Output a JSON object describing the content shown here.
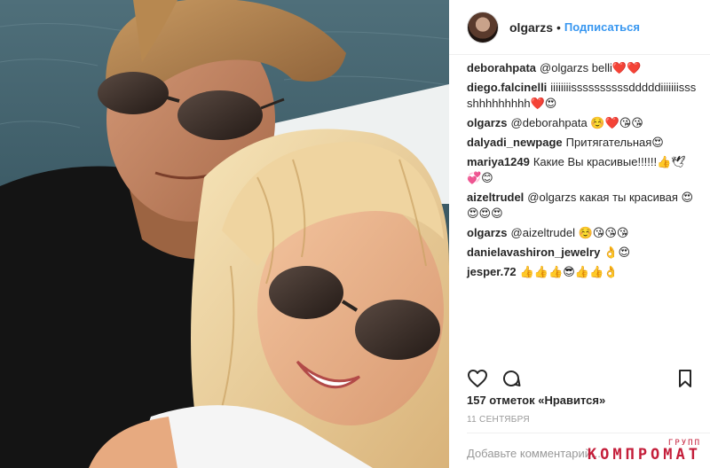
{
  "post": {
    "username": "olgarzs",
    "separator": "•",
    "follow_label": "Подписаться"
  },
  "comments": [
    {
      "user": "deborahpata",
      "text": "@olgarzs belli❤️❤️"
    },
    {
      "user": "diego.falcinelli",
      "text": "iiiiiiiissssssssssdddddiiiiiiisssshhhhhhhhh❤️😍"
    },
    {
      "user": "olgarzs",
      "text": "@deborahpata ☺️❤️😘😘"
    },
    {
      "user": "dalyadi_newpage",
      "text": "Притягательная😍"
    },
    {
      "user": "mariya1249",
      "text": "Какие Вы красивые!!!!!!👍🕊💞😊"
    },
    {
      "user": "aizeltrudel",
      "text": "@olgarzs какая ты красивая 😍😍😍😍"
    },
    {
      "user": "olgarzs",
      "text": "@aizeltrudel ☺️😘😘😘"
    },
    {
      "user": "danielavashiron_jewelry",
      "text": "👌😍"
    },
    {
      "user": "jesper.72",
      "text": "👍👍👍😎👍👍👌"
    }
  ],
  "actions": {
    "like_icon": "heart-icon",
    "comment_icon": "speech-bubble-icon",
    "save_icon": "bookmark-icon"
  },
  "likes_text": "157 отметок «Нравится»",
  "date_text": "11 СЕНТЯБРЯ",
  "comment_input": {
    "placeholder": "Добавьте комментарий..."
  },
  "watermark": {
    "top": "ГРУПП",
    "main": "КОМПРОМАТ"
  },
  "colors": {
    "link": "#3897f0",
    "watermark": "#c41e3a"
  }
}
